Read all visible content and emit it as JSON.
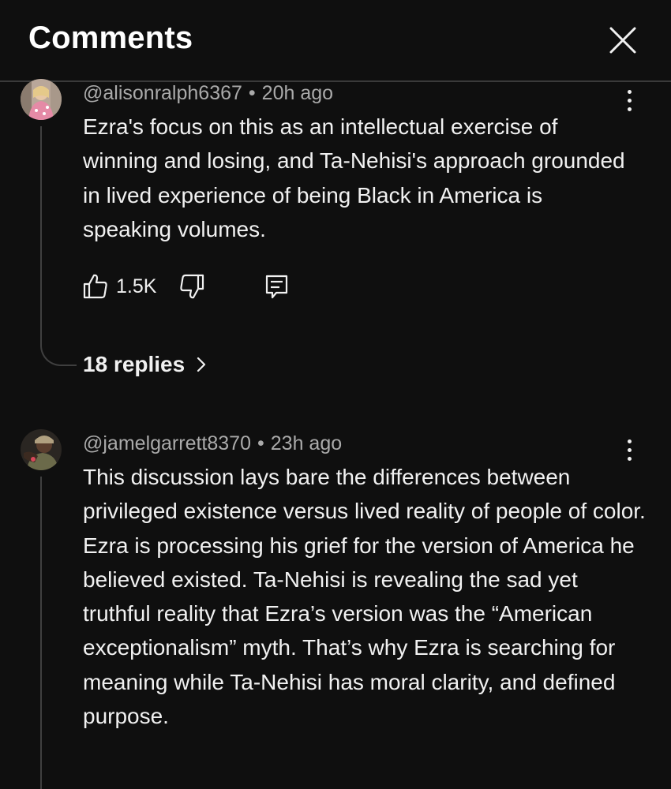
{
  "header": {
    "title": "Comments",
    "close_icon": "close-icon"
  },
  "comments": [
    {
      "author": "@alisonralph6367",
      "separator": "•",
      "time": "20h ago",
      "text": "Ezra's focus on this as an intellectual exercise of winning and losing, and Ta-Nehisi's approach grounded in lived experience of being Black in America is speaking volumes.",
      "likes": "1.5K",
      "replies_label": "18 replies",
      "icons": [
        "thumbs-up-icon",
        "thumbs-down-icon",
        "reply-icon",
        "more-vert-icon",
        "chevron-right-icon"
      ]
    },
    {
      "author": "@jamelgarrett8370",
      "separator": "•",
      "time": "23h ago",
      "text": "This discussion lays bare the differences between  privileged existence versus lived reality of people of color. Ezra is processing his grief for the version of America he believed existed. Ta-Nehisi is revealing the sad yet truthful reality that Ezra’s version was the “American exceptionalism” myth. That’s why Ezra is searching for meaning while Ta-Nehisi has moral clarity, and defined purpose.",
      "icons": [
        "more-vert-icon"
      ]
    }
  ],
  "colors": {
    "background": "#0f0f0f",
    "text_primary": "#f1f1f1",
    "text_secondary": "#aaaaaa",
    "divider": "#3a3a3a"
  }
}
